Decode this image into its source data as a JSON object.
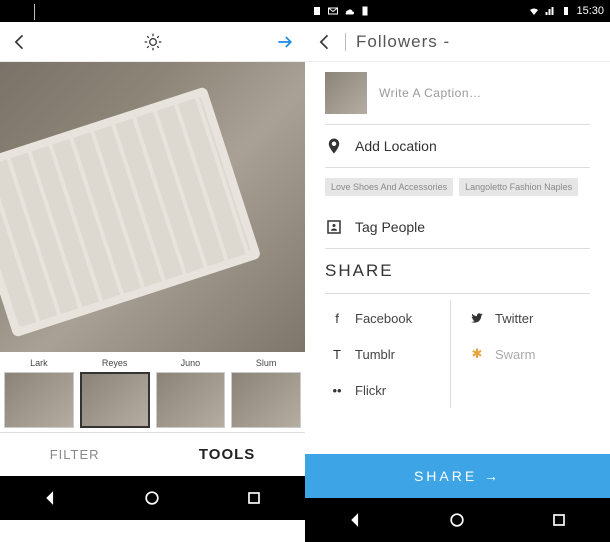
{
  "status": {
    "time": "15:30"
  },
  "editor": {
    "filters": [
      "Lark",
      "Reyes",
      "Juno",
      "Slum"
    ],
    "selectedFilter": 1,
    "tabs": {
      "filter": "FILTER",
      "tools": "TOOLS"
    },
    "activeTab": "tools"
  },
  "share": {
    "title": "Followers -",
    "captionPlaceholder": "Write A Caption…",
    "addLocation": "Add Location",
    "suggestions": [
      "Love Shoes And Accessories",
      "Langoletto Fashion Naples"
    ],
    "tagPeople": "Tag People",
    "shareHeading": "SHARE",
    "options": {
      "facebook": "Facebook",
      "twitter": "Twitter",
      "tumblr": "Tumblr",
      "swarm": "Swarm",
      "flickr": "Flickr"
    },
    "button": "SHARE →"
  }
}
